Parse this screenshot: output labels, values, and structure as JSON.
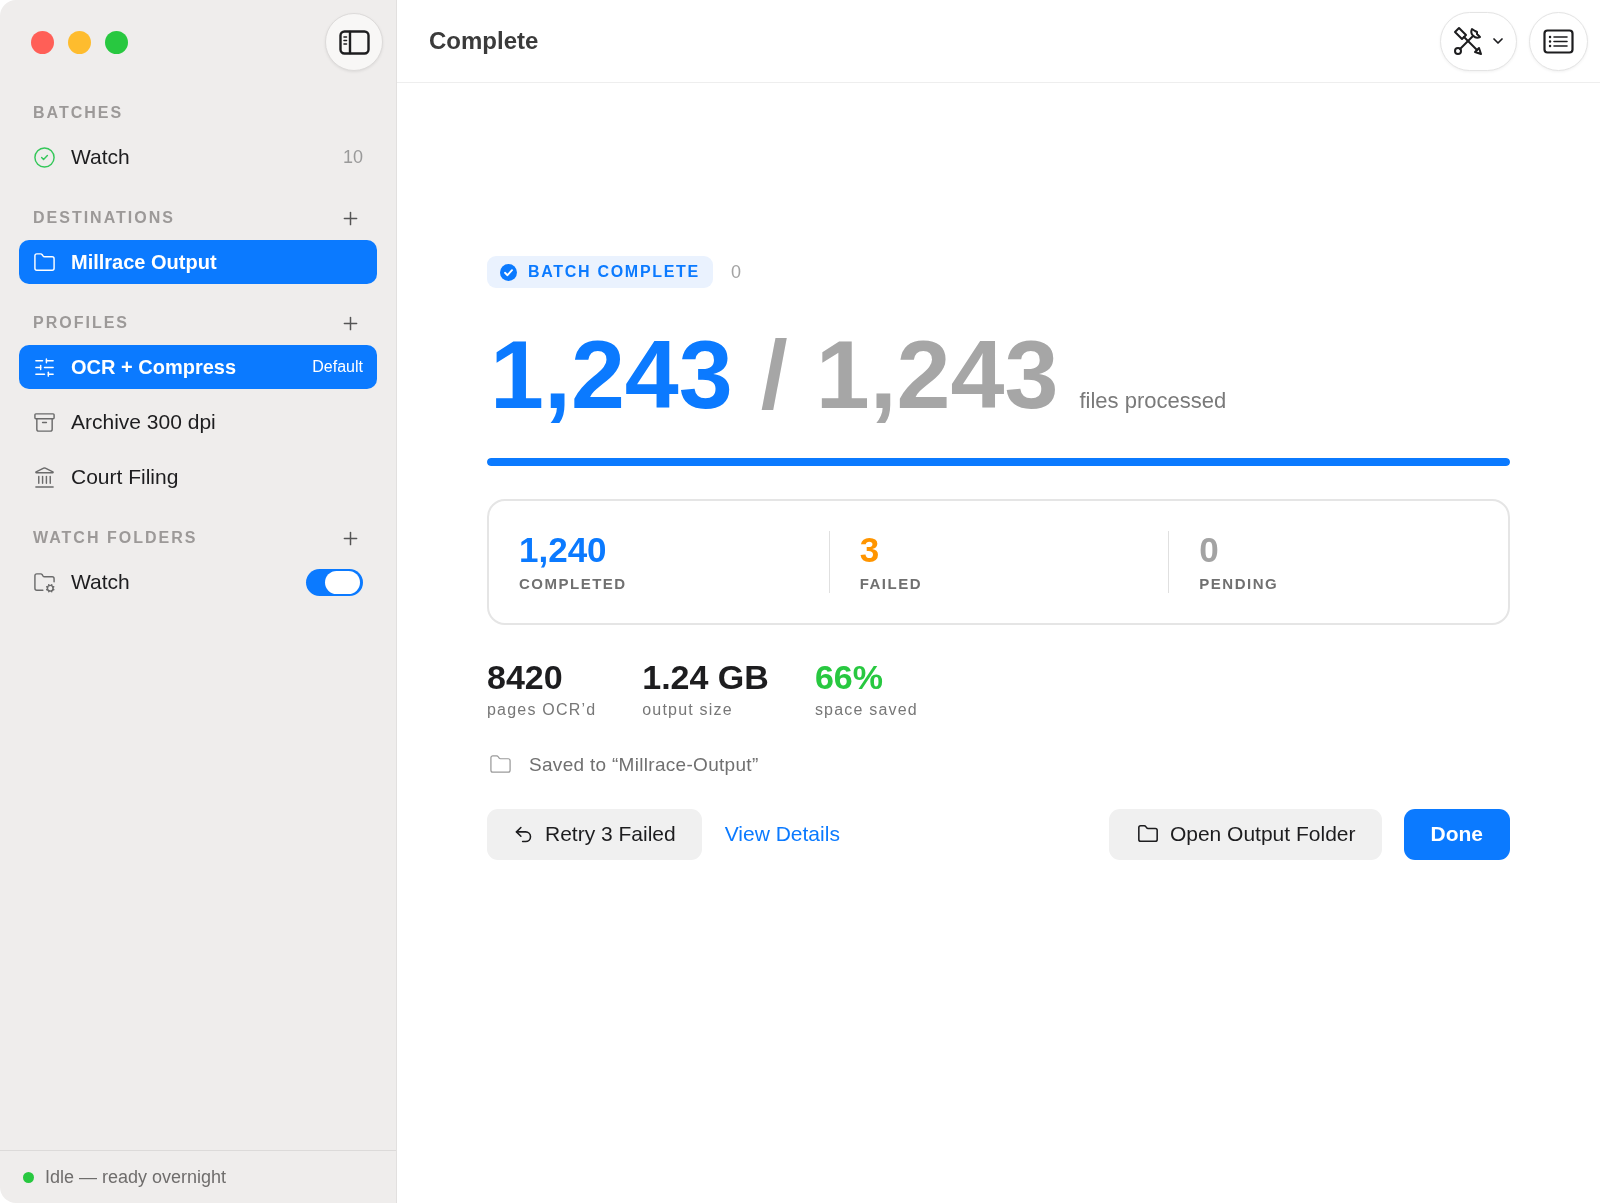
{
  "sidebar": {
    "sections": [
      {
        "title": "BATCHES",
        "add": false,
        "items": [
          {
            "kind": "batch",
            "label": "Watch",
            "count": "10",
            "selected": false
          }
        ]
      },
      {
        "title": "DESTINATIONS",
        "add": true,
        "items": [
          {
            "kind": "destination",
            "label": "Millrace Output",
            "selected": true
          }
        ]
      },
      {
        "title": "PROFILES",
        "add": true,
        "items": [
          {
            "kind": "ocr-profile",
            "label": "OCR + Compress",
            "badge": "Default",
            "selected": true
          },
          {
            "kind": "archive-profile",
            "label": "Archive 300 dpi",
            "selected": false
          },
          {
            "kind": "filing-profile",
            "label": "Court Filing",
            "selected": false
          }
        ]
      },
      {
        "title": "WATCH FOLDERS",
        "add": true,
        "items": [
          {
            "kind": "watch-folder",
            "label": "Watch",
            "on": true,
            "selected": false
          }
        ]
      }
    ],
    "status": {
      "text": "Idle — ready overnight",
      "color": "#28c840"
    }
  },
  "header": {
    "title": "Complete"
  },
  "summary": {
    "badge": "BATCH COMPLETE",
    "counter": "0",
    "done": "1,243",
    "separator": "/",
    "total": "1,243",
    "caption": "files processed",
    "progress": {
      "level": 1
    }
  },
  "counts": [
    {
      "value": "1,240",
      "label": "COMPLETED",
      "color": "#0b7aff"
    },
    {
      "value": "3",
      "label": "FAILED",
      "color": "#ff9500"
    },
    {
      "value": "0",
      "label": "PENDING",
      "color": "#a3a3a3"
    }
  ],
  "metrics": [
    {
      "value": "8420",
      "label": "pages OCR’d",
      "color": "#1d1d1f"
    },
    {
      "value": "1.24 GB",
      "label": "output size",
      "color": "#1d1d1f"
    },
    {
      "value": "66%",
      "label": "space saved",
      "color": "#28c840"
    }
  ],
  "saved_to": "Saved to “Millrace-Output”",
  "actions": {
    "left": [
      {
        "kind": "retry",
        "label": "Retry 3 Failed"
      },
      {
        "kind": "link",
        "label": "View Details"
      }
    ],
    "right": [
      {
        "kind": "folder",
        "label": "Open Output Folder"
      },
      {
        "kind": "primary",
        "label": "Done"
      }
    ]
  }
}
